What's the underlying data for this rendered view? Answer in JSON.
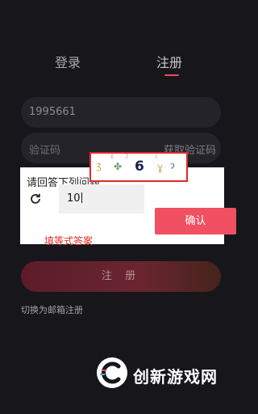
{
  "tabs": {
    "login": "登录",
    "register": "注册"
  },
  "form": {
    "phone_value": "1995661",
    "code_placeholder": "验证码",
    "get_code": "获取验证码",
    "register_label": "注 册",
    "switch_email": "切换为邮箱注册"
  },
  "captcha": {
    "question": "请回答下列问题",
    "image_digit": "6",
    "input_value": "10",
    "confirm_label": "确认",
    "annotation": "填等式答案"
  },
  "watermark": {
    "text": "创新游戏网"
  },
  "colors": {
    "accent": "#f05062",
    "highlight_box": "#e1262c",
    "annotation": "#e0302a",
    "background": "#17161b"
  },
  "icons": [
    "refresh-icon",
    "watermark-logo-icon"
  ]
}
